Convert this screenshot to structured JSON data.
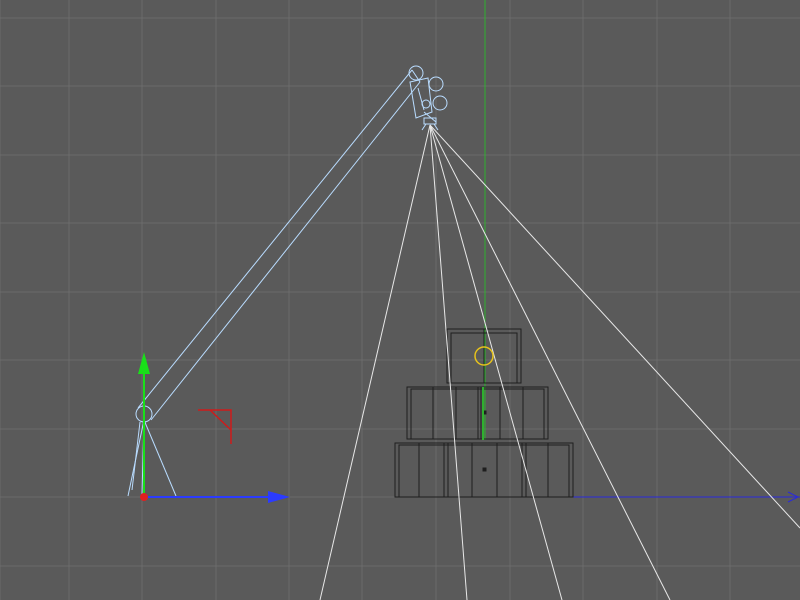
{
  "viewport": {
    "projection": "orthographic-front",
    "background_color": "#5a5a5a",
    "grid_color": "#6b6b6b",
    "shows_text": false
  },
  "colors": {
    "world_y_axis": "#2fb02f",
    "world_x_axis": "#2a2adc",
    "gizmo_y": "#19e019",
    "gizmo_x": "#2b3bff",
    "gizmo_origin": "#e02020",
    "camera_wireframe": "#b9dcff",
    "frustum_lines": "#e8e8e8",
    "stacked_boxes": "#1e1e1e",
    "target_marker": "#e6c21c",
    "pivot_corner": "#d01a1a"
  },
  "objects": [
    {
      "name": "crane-camera-rig",
      "icon": "camera-icon"
    },
    {
      "name": "tripod-base",
      "icon": "tripod-icon"
    },
    {
      "name": "camera-frustum",
      "icon": "frustum-icon"
    },
    {
      "name": "stacked-boxes",
      "icon": "box-icon",
      "rows": [
        1,
        2,
        3
      ]
    },
    {
      "name": "look-at-target",
      "icon": "target-icon"
    },
    {
      "name": "move-gizmo",
      "icon": "move-arrows-icon"
    },
    {
      "name": "world-axes",
      "icon": "axes-icon"
    }
  ]
}
